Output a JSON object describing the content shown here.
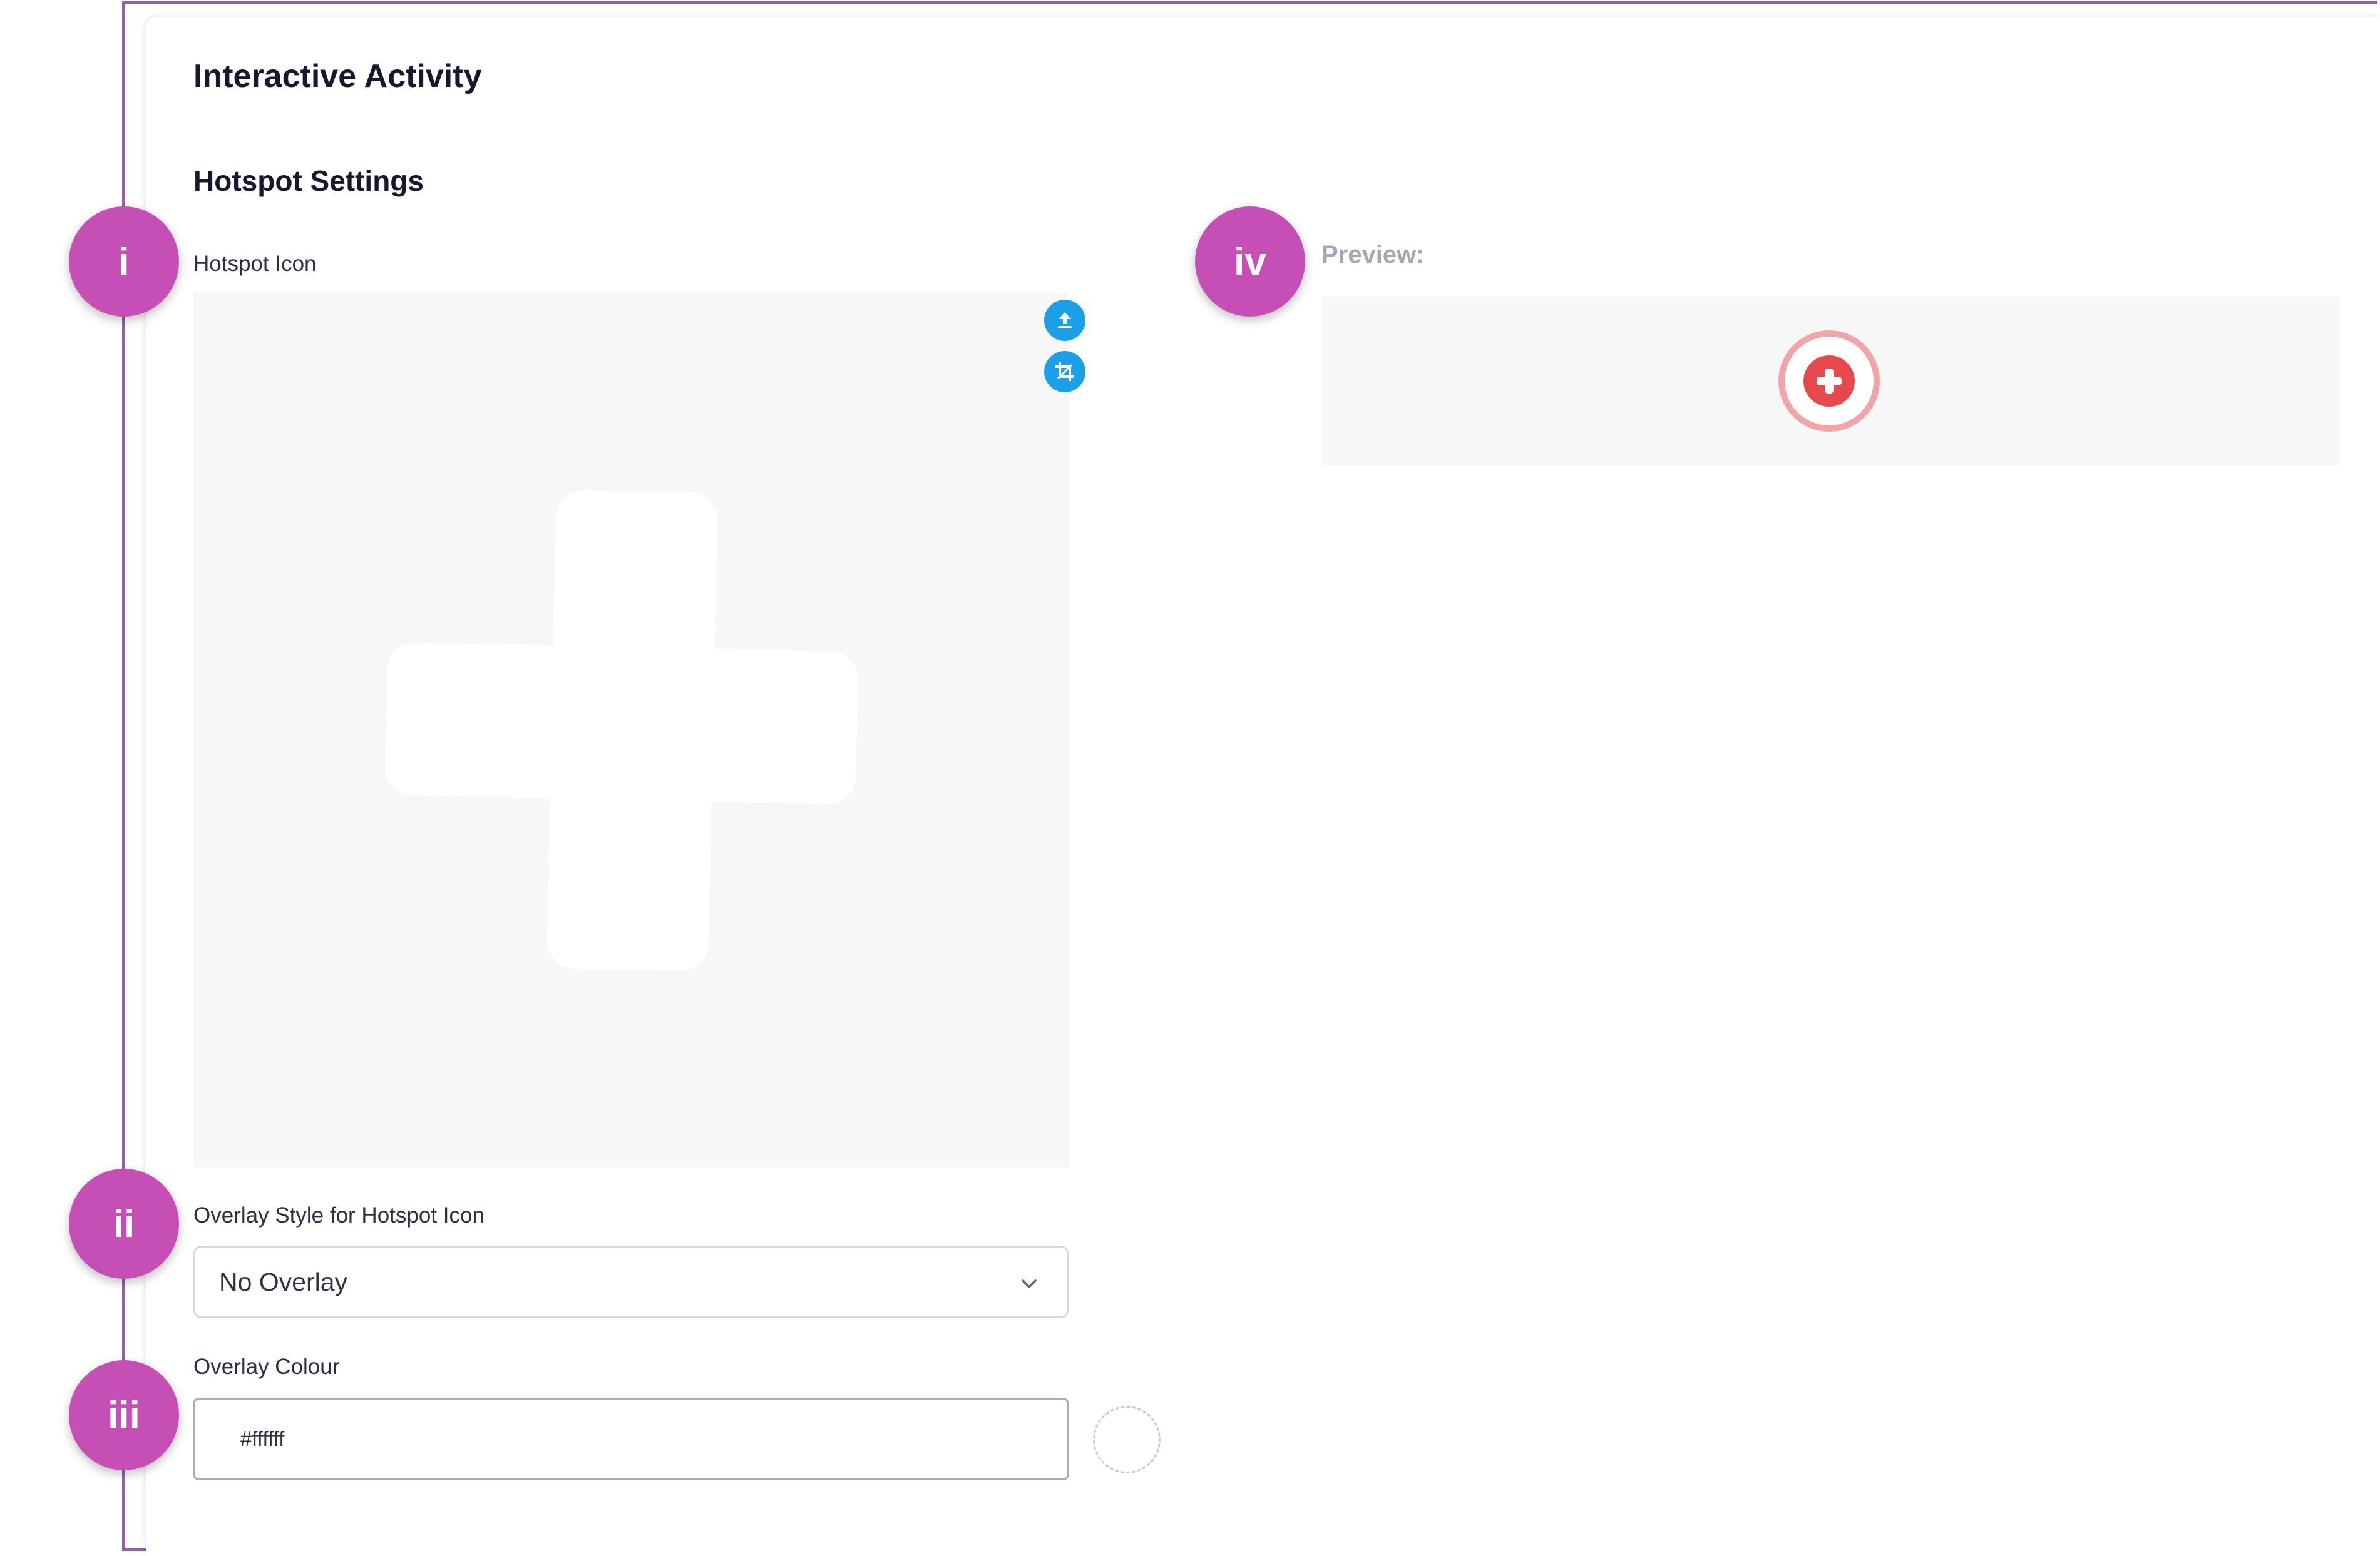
{
  "header": {
    "title": "Interactive Activity"
  },
  "section": {
    "title": "Hotspot Settings"
  },
  "hotspot_icon": {
    "label": "Hotspot Icon"
  },
  "overlay_style": {
    "label": "Overlay Style for Hotspot Icon",
    "selected": "No Overlay"
  },
  "overlay_colour": {
    "label": "Overlay Colour",
    "value": "#ffffff"
  },
  "preview": {
    "label": "Preview:"
  },
  "badges": [
    "i",
    "ii",
    "iii",
    "iv"
  ],
  "colors": {
    "badge": "#c54fb5",
    "action_button": "#1b9fe6",
    "hotspot_red": "#e5484d",
    "frame_border": "#9b59b6"
  }
}
